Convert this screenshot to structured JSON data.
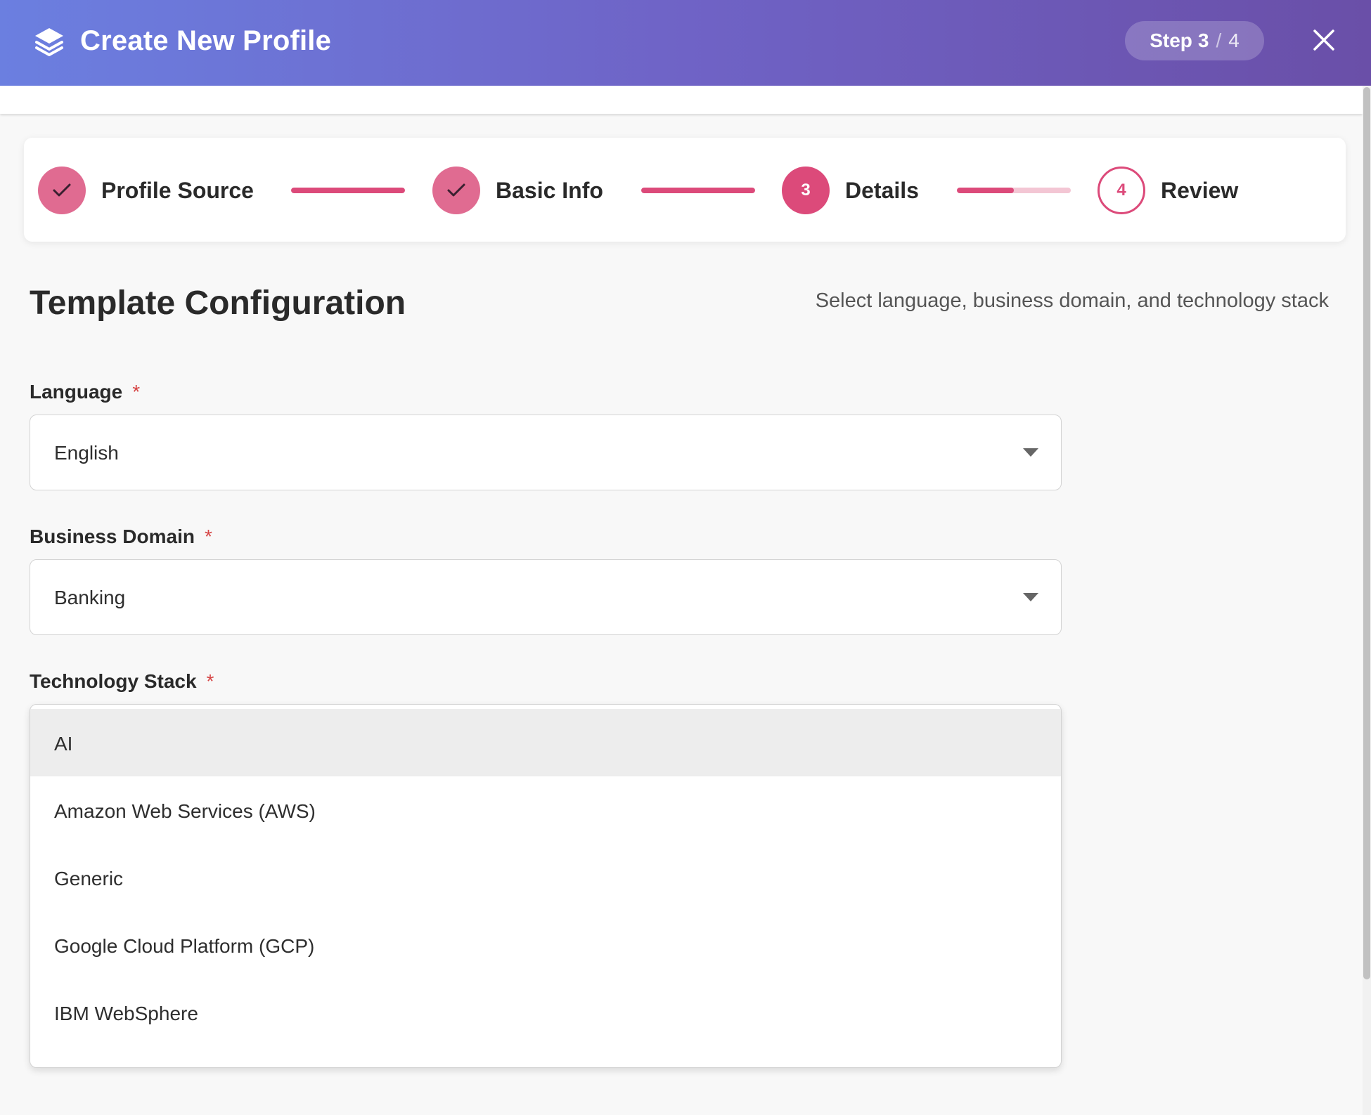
{
  "header": {
    "title": "Create New Profile",
    "step_label": "Step",
    "step_current": "3",
    "step_separator": "/",
    "step_total": "4"
  },
  "stepper": {
    "steps": [
      {
        "label": "Profile Source",
        "state": "done",
        "marker": ""
      },
      {
        "label": "Basic Info",
        "state": "done",
        "marker": ""
      },
      {
        "label": "Details",
        "state": "active",
        "marker": "3"
      },
      {
        "label": "Review",
        "state": "pending",
        "marker": "4"
      }
    ],
    "connector_progress": [
      1.0,
      1.0,
      0.5
    ]
  },
  "section": {
    "title": "Template Configuration",
    "subtitle": "Select language, business domain, and technology stack"
  },
  "fields": {
    "language": {
      "label": "Language",
      "required_mark": "*",
      "value": "English"
    },
    "business_domain": {
      "label": "Business Domain",
      "required_mark": "*",
      "value": "Banking"
    },
    "technology_stack": {
      "label": "Technology Stack",
      "required_mark": "*",
      "options": [
        "AI",
        "Amazon Web Services (AWS)",
        "Generic",
        "Google Cloud Platform (GCP)",
        "IBM WebSphere"
      ],
      "highlighted_index": 0
    }
  },
  "colors": {
    "accent": "#dc4a7a",
    "accent_done": "#e06b91",
    "header_gradient_start": "#6b7fe0",
    "header_gradient_end": "#6a4fa8",
    "required": "#d64545"
  },
  "icons": {
    "logo": "layers-icon",
    "close": "close-icon",
    "done_step": "check-icon",
    "select_caret": "caret-down-icon"
  }
}
